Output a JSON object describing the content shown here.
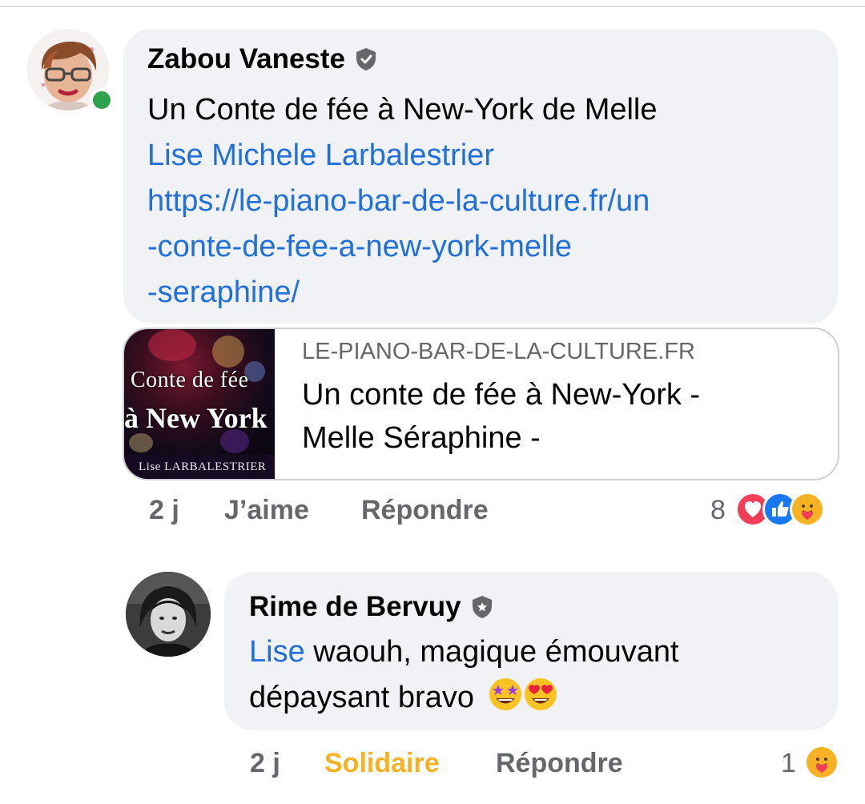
{
  "comments": [
    {
      "author": "Zabou Vaneste",
      "badge_icon": "shield-badge-icon",
      "online": true,
      "text_lines": [
        {
          "text": "Un Conte de fée à New-York de Melle",
          "is_link": false
        },
        {
          "text": "Lise Michele Larbalestrier",
          "is_link": true
        },
        {
          "text": "https://le-piano-bar-de-la-culture.fr/un",
          "is_link": true
        },
        {
          "text": "-conte-de-fee-a-new-york-melle",
          "is_link": true
        },
        {
          "text": "-seraphine/",
          "is_link": true
        }
      ],
      "link_preview": {
        "domain": "LE-PIANO-BAR-DE-LA-CULTURE.FR",
        "title_lines": [
          "Un conte de fée à New-York -",
          "Melle Séraphine -"
        ],
        "thumbnail": {
          "line1": "Conte de fée",
          "line2": "à New York",
          "caption": "Lise LARBALESTRIER"
        }
      },
      "actions": {
        "time": "2 j",
        "react_label": "J’aime",
        "reply_label": "Répondre"
      },
      "reactions": {
        "count": "8",
        "icons": [
          "love-reaction-icon",
          "like-reaction-icon",
          "care-reaction-icon"
        ]
      }
    },
    {
      "author": "Rime de Bervuy",
      "badge_icon": "shield-badge-icon",
      "mention": "Lise",
      "text_line1": " waouh, magique émouvant",
      "text_line2": "dépaysant bravo",
      "emojis": [
        "star-struck-emoji-icon",
        "heart-eyes-emoji-icon"
      ],
      "actions": {
        "time": "2 j",
        "react_label": "Solidaire",
        "reply_label": "Répondre"
      },
      "reactions": {
        "count": "1",
        "icons": [
          "care-reaction-icon"
        ]
      }
    }
  ],
  "colors": {
    "link": "#216fdb",
    "bubble": "#f0f2f5",
    "secondary_text": "#65676b",
    "care_reaction": "#f7b125",
    "online": "#31a24c"
  }
}
